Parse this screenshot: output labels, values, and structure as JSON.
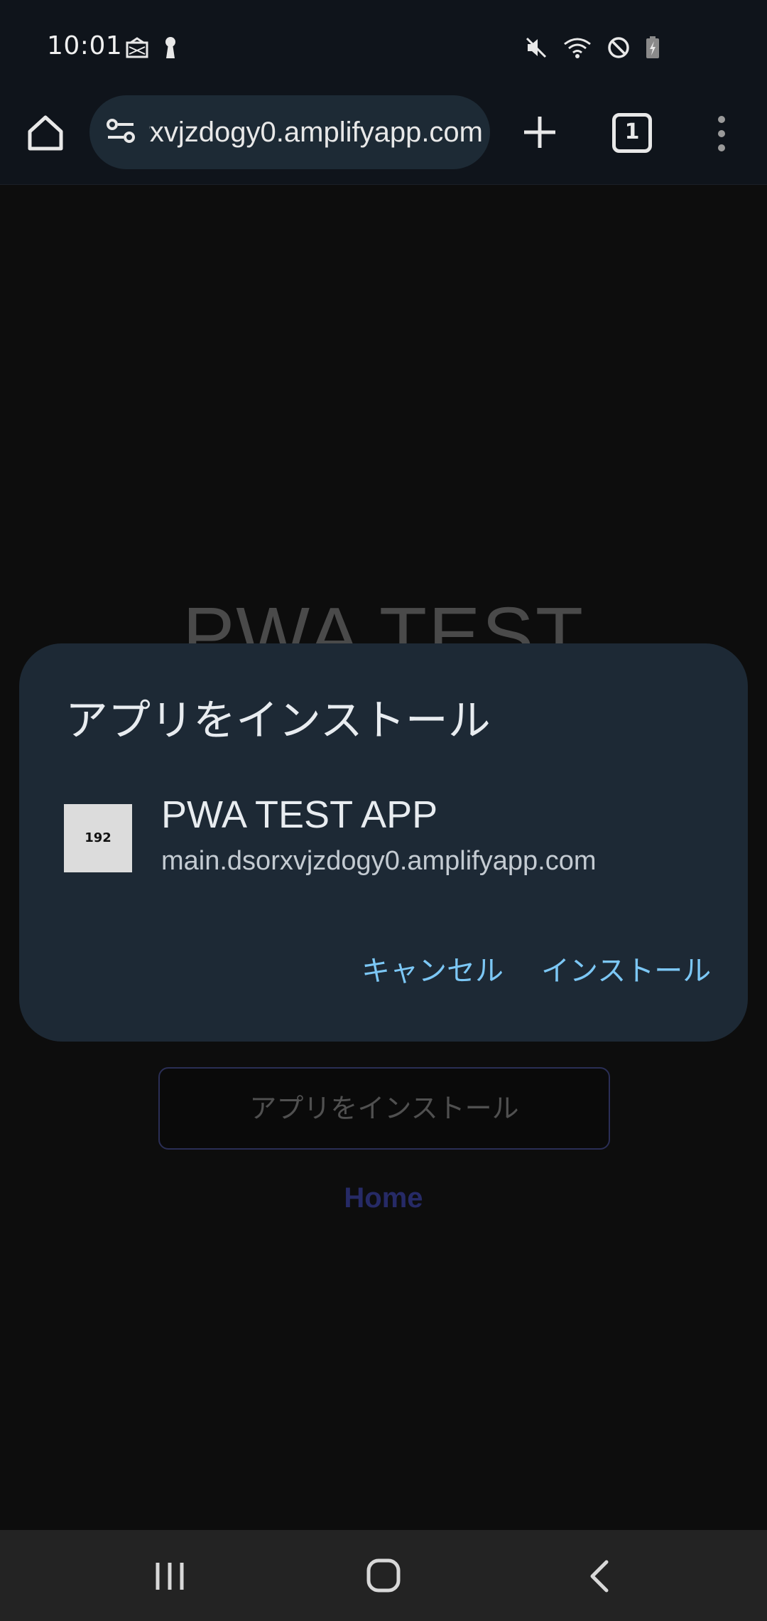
{
  "status_bar": {
    "time": "10:01"
  },
  "browser": {
    "url": "main.dsorxvjzdogy0.amplifyapp.com",
    "tab_count": "1"
  },
  "page": {
    "heading": "PWA TEST",
    "install_button": "アプリをインストール",
    "home_link": "Home"
  },
  "dialog": {
    "title": "アプリをインストール",
    "app_icon_text": "192",
    "app_name": "PWA TEST APP",
    "app_url": "main.dsorxvjzdogy0.amplifyapp.com",
    "cancel_label": "キャンセル",
    "install_label": "インストール"
  },
  "colors": {
    "dialog_bg": "#1d2935",
    "accent": "#7cc7f5",
    "toolbar_bg": "#0f141b"
  }
}
